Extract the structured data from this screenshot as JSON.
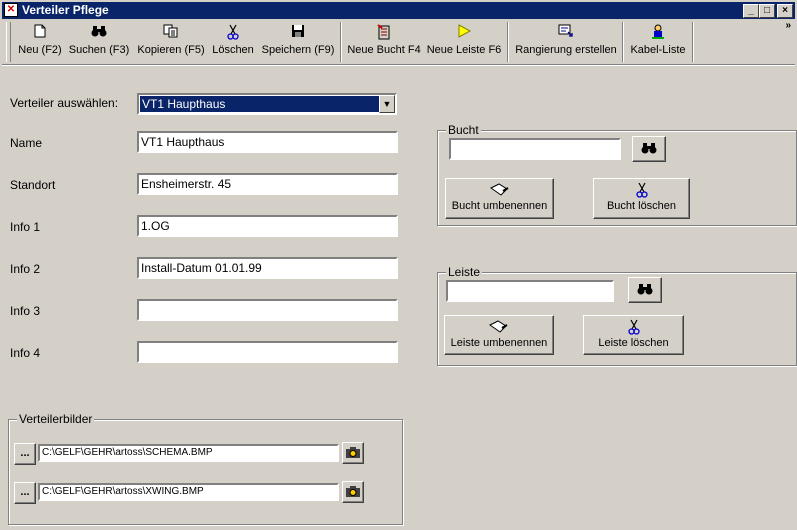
{
  "window": {
    "title": "Verteiler Pflege"
  },
  "toolbar": {
    "items": [
      {
        "label": "Neu (F2)",
        "icon": "new-document-icon"
      },
      {
        "label": "Suchen (F3)",
        "icon": "binoculars-icon"
      },
      {
        "label": "Kopieren (F5)",
        "icon": "copy-icon"
      },
      {
        "label": "Löschen",
        "icon": "scissors-icon"
      },
      {
        "label": "Speichern (F9)",
        "icon": "floppy-disk-icon"
      },
      {
        "label": "Neue Bucht F4",
        "icon": "new-bay-icon"
      },
      {
        "label": "Neue Leiste F6",
        "icon": "yellow-triangle-icon"
      },
      {
        "label": "Rangierung erstellen",
        "icon": "patching-icon"
      },
      {
        "label": "Kabel-Liste",
        "icon": "cable-list-icon"
      }
    ]
  },
  "form": {
    "verteiler_label": "Verteiler auswählen:",
    "verteiler_value": "VT1 Haupthaus",
    "fields": [
      {
        "label": "Name",
        "value": "VT1 Haupthaus"
      },
      {
        "label": "Standort",
        "value": "Ensheimerstr. 45"
      },
      {
        "label": "Info 1",
        "value": "1.OG"
      },
      {
        "label": "Info 2",
        "value": "Install-Datum 01.01.99"
      },
      {
        "label": "Info 3",
        "value": ""
      },
      {
        "label": "Info 4",
        "value": ""
      }
    ]
  },
  "bucht": {
    "title": "Bucht",
    "value": "",
    "rename_label": "Bucht umbenennen",
    "delete_label": "Bucht löschen"
  },
  "leiste": {
    "title": "Leiste",
    "value": "",
    "rename_label": "Leiste umbenennen",
    "delete_label": "Leiste löschen"
  },
  "bilder": {
    "title": "Verteilerbilder",
    "browse_label": "...",
    "paths": [
      "C:\\GELF\\GEHR\\artoss\\SCHEMA.BMP",
      "C:\\GELF\\GEHR\\artoss\\XWING.BMP"
    ]
  }
}
